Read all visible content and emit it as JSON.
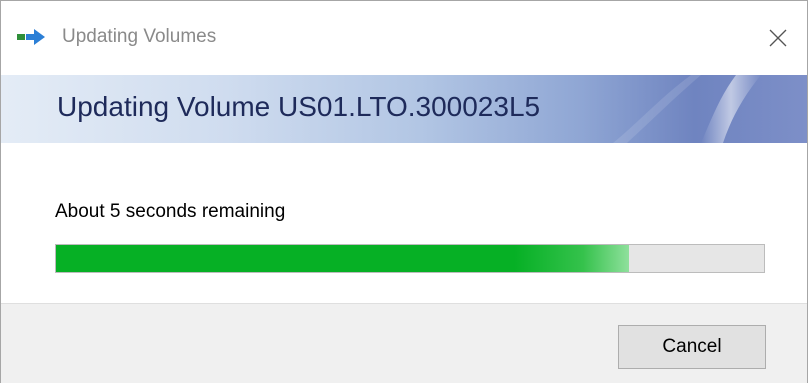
{
  "window": {
    "title": "Updating Volumes",
    "app_icon": "move-arrow-icon",
    "close_icon": "close-icon"
  },
  "banner": {
    "heading": "Updating Volume US01.LTO.300023L5"
  },
  "status": {
    "text": "About 5 seconds remaining"
  },
  "progress": {
    "percent": 81,
    "fill_color": "#06b025",
    "track_color": "#e6e6e6"
  },
  "footer": {
    "cancel_label": "Cancel"
  }
}
